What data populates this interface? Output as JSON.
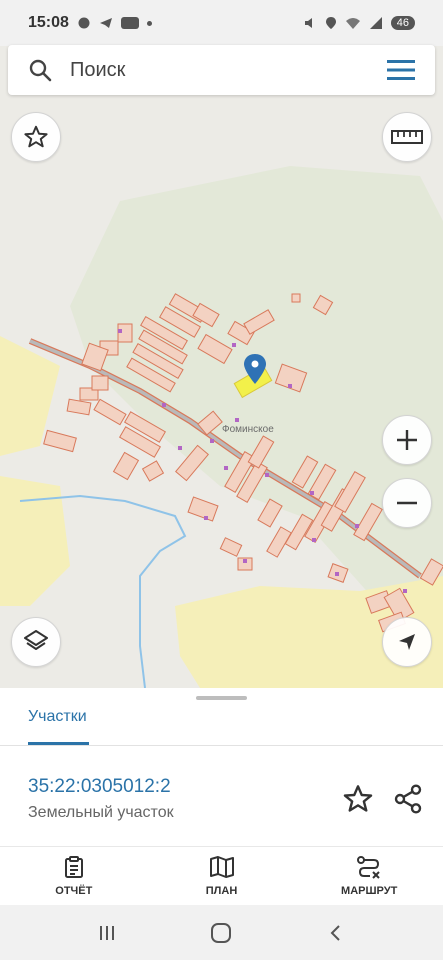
{
  "status_bar": {
    "time": "15:08",
    "battery": "46"
  },
  "search": {
    "placeholder": "Поиск"
  },
  "map": {
    "place_label": "Фоминское",
    "colors": {
      "background": "#ecebe6",
      "forest": "#e3e8d8",
      "field": "#f5efb9",
      "parcel_fill": "#f3d2c2",
      "parcel_stroke": "#d8795b",
      "selected_parcel": "#f2f04a",
      "road": "#b9b9b9",
      "river": "#8fc3e8",
      "pin": "#2f72b5"
    },
    "buttons": {
      "favorite": "star-icon",
      "ruler": "ruler-icon",
      "zoom_in": "plus-icon",
      "zoom_out": "minus-icon",
      "layers": "layers-icon",
      "locate": "navigation-arrow-icon"
    }
  },
  "sheet": {
    "tab_label": "Участки",
    "cadastral_number": "35:22:0305012:2",
    "object_type": "Земельный участок"
  },
  "bottom_nav": {
    "items": [
      {
        "label": "ОТЧЁТ",
        "icon": "report-clipboard-icon"
      },
      {
        "label": "ПЛАН",
        "icon": "map-plan-icon"
      },
      {
        "label": "МАРШРУТ",
        "icon": "route-icon"
      }
    ]
  }
}
